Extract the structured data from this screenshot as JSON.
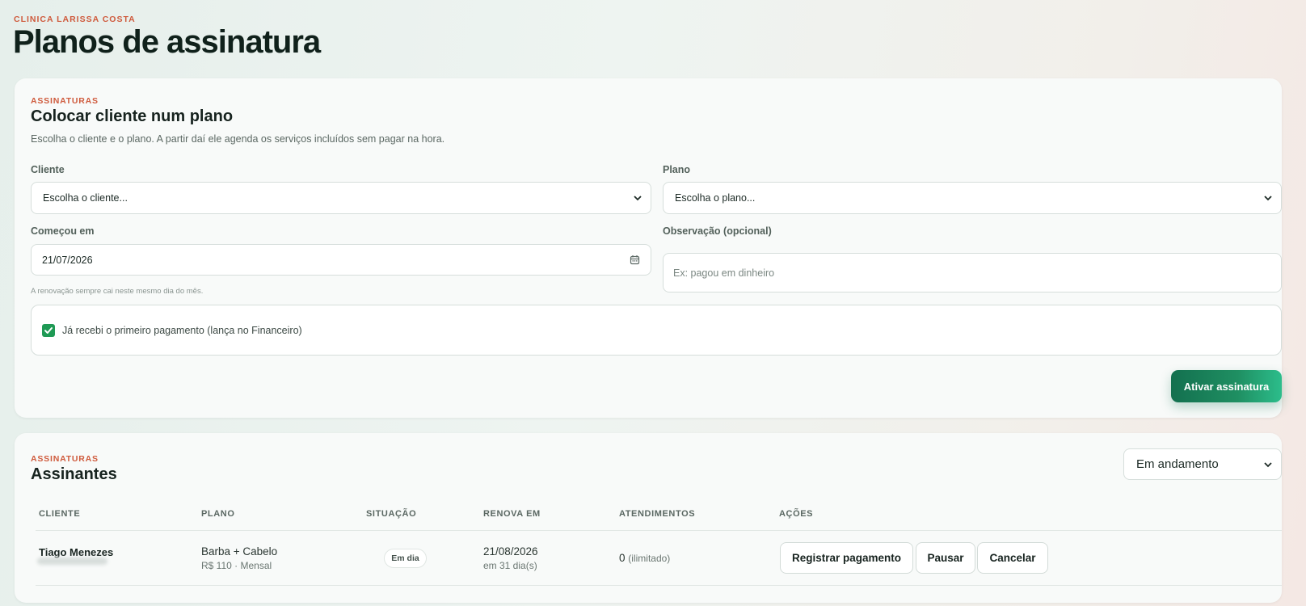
{
  "header": {
    "brand": "CLINICA LARISSA COSTA",
    "title": "Planos de assinatura"
  },
  "form": {
    "eyebrow": "ASSINATURAS",
    "title": "Colocar cliente num plano",
    "description": "Escolha o cliente e o plano. A partir daí ele agenda os serviços incluídos sem pagar na hora.",
    "client_label": "Cliente",
    "client_value": "Escolha o cliente...",
    "plan_label": "Plano",
    "plan_value": "Escolha o plano...",
    "start_label": "Começou em",
    "start_value": "21/07/2026",
    "start_hint": "A renovação sempre cai neste mesmo dia do mês.",
    "note_label": "Observação (opcional)",
    "note_placeholder": "Ex: pagou em dinheiro",
    "note_value": "",
    "payment_checkbox_label": "Já recebi o primeiro pagamento (lança no Financeiro)",
    "payment_checked": true,
    "submit_label": "Ativar assinatura"
  },
  "subscribers": {
    "eyebrow": "ASSINATURAS",
    "title": "Assinantes",
    "filter_value": "Em andamento",
    "columns": [
      "CLIENTE",
      "PLANO",
      "SITUAÇÃO",
      "RENOVA EM",
      "ATENDIMENTOS",
      "AÇÕES"
    ],
    "rows": [
      {
        "client": "Tiago Menezes",
        "plan": "Barba + Cabelo",
        "plan_detail": "R$ 110 · Mensal",
        "status": "Em dia",
        "renews_on": "21/08/2026",
        "renews_in": "em 31 dia(s)",
        "visits_count": "0",
        "visits_limit": "(ilimitado)",
        "actions": [
          "Registrar pagamento",
          "Pausar",
          "Cancelar"
        ]
      }
    ]
  },
  "colors": {
    "accent": "#cf5a3c",
    "primary": "#1f8f62",
    "check": "#1f9a55"
  },
  "icons": {
    "select": "chevron-down-icon",
    "date": "calendar-icon",
    "checkbox": "checkmark-icon"
  }
}
